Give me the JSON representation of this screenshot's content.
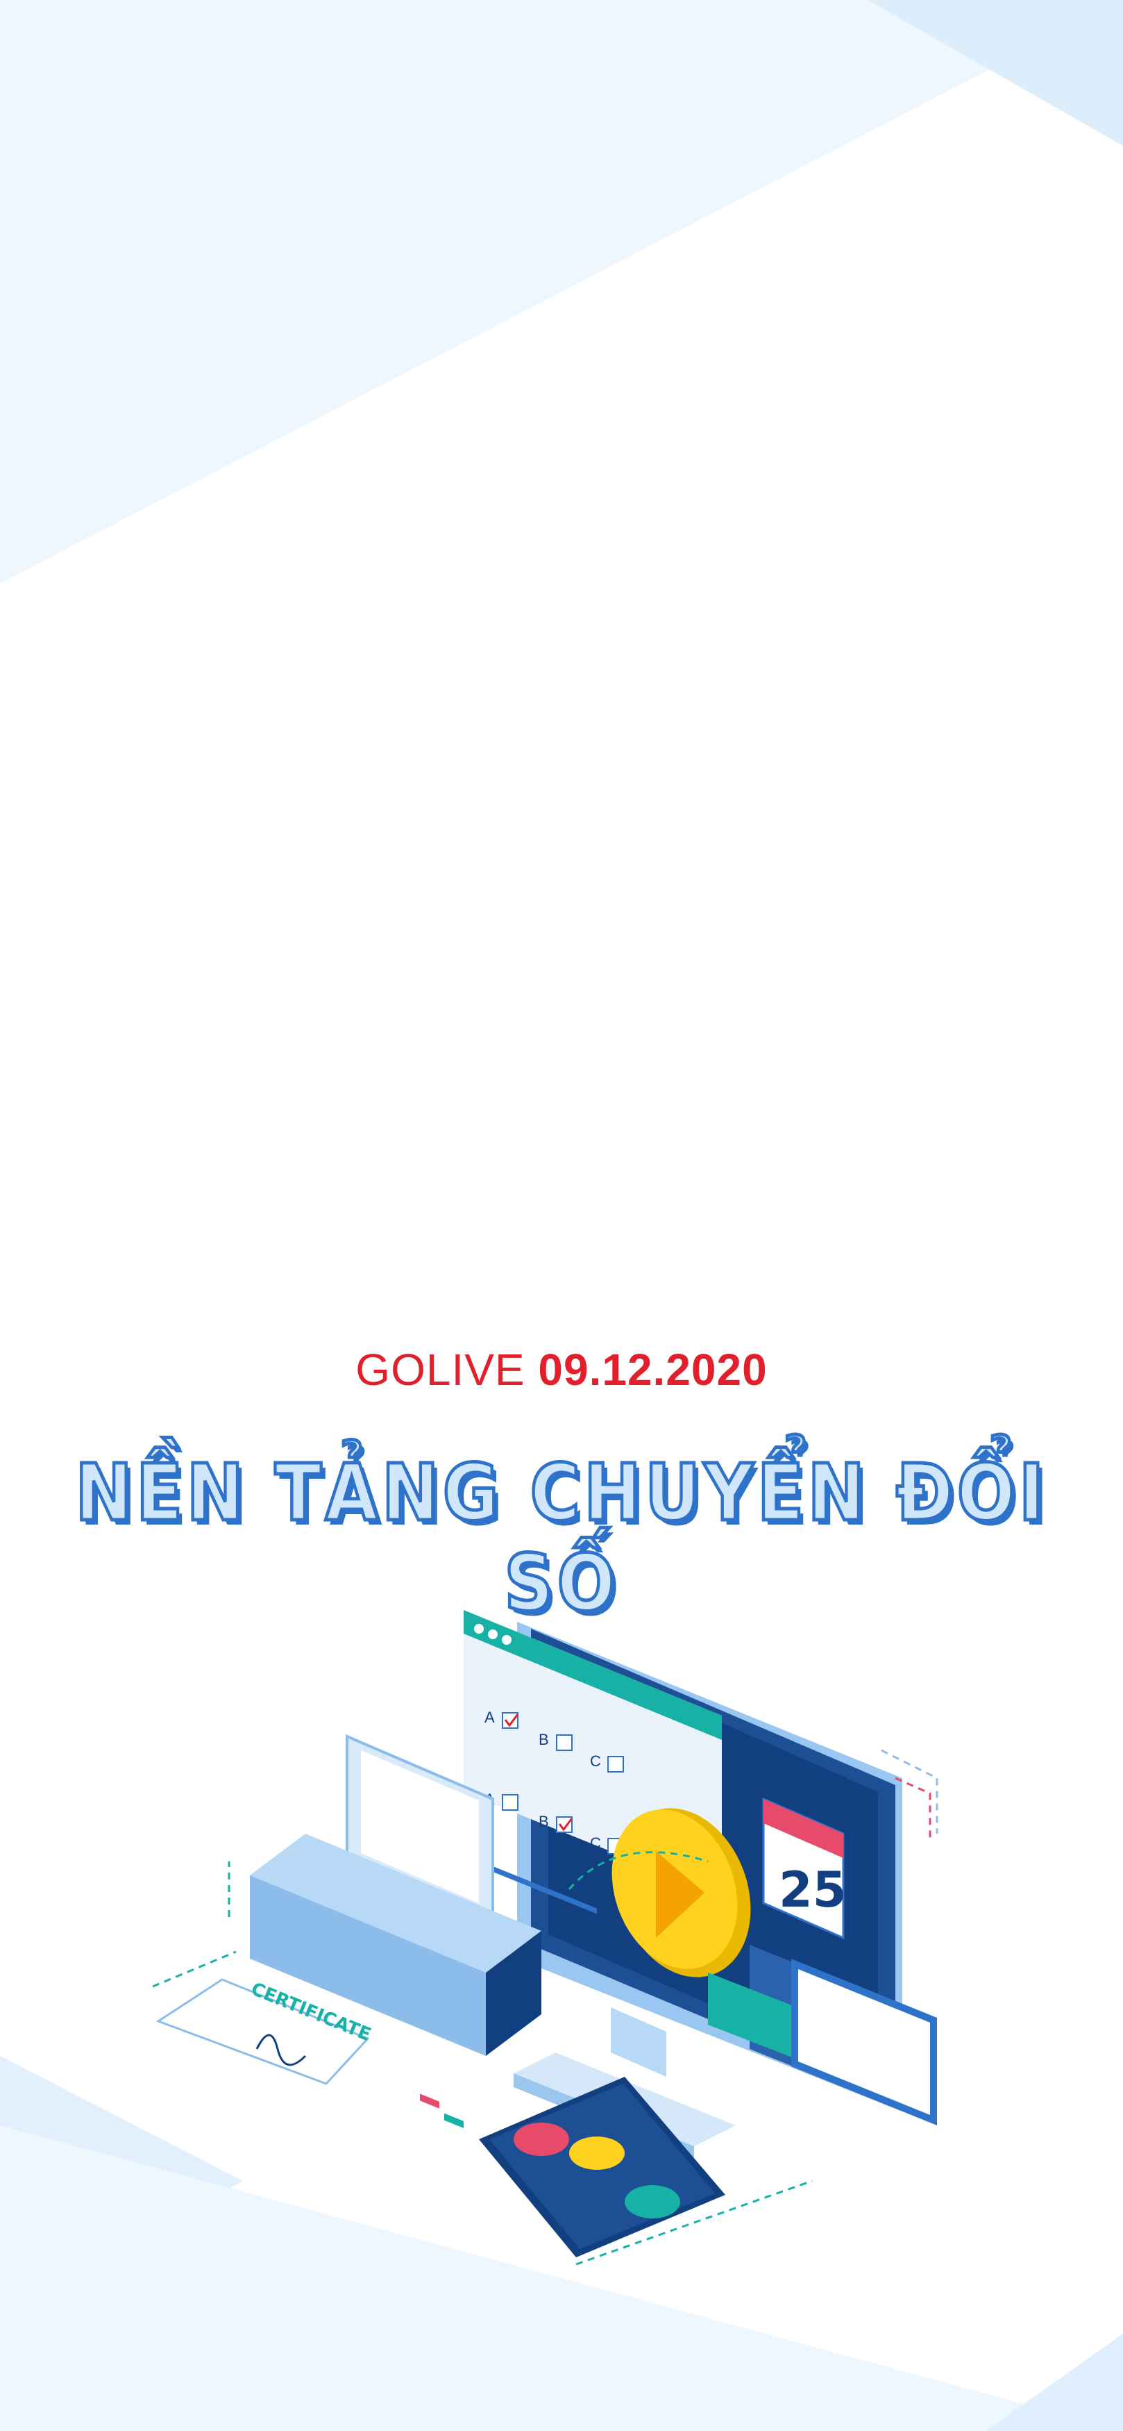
{
  "banner": {
    "golive_word": "GOLIVE",
    "golive_date": "09.12.2020",
    "headline": "NỀN TẢNG CHUYỂN ĐỔI SỐ"
  },
  "illustration": {
    "certificate_text": "CERTIFICATE",
    "calendar_day": "25",
    "quiz_options": [
      "A",
      "B",
      "C",
      "A",
      "B",
      "C"
    ]
  },
  "colors": {
    "accent_red": "#e1202b",
    "headline_blue": "#2f72c9",
    "headline_fill": "#cfe6fb",
    "background_tint": "#eaf4fd",
    "navy": "#123f7f",
    "teal": "#17b1a6",
    "yellow": "#ffd21f"
  }
}
